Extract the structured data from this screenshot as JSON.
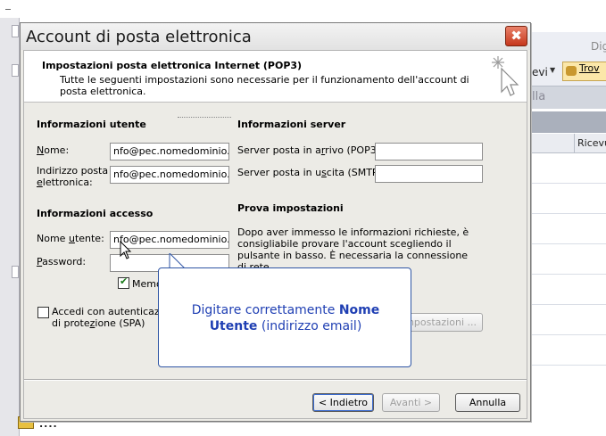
{
  "background": {
    "toolbar_partial_text": "Digi",
    "menu_partial": "evi",
    "find_button_partial": "Trov",
    "header_partial": "lla",
    "column_header_partial": "Ricevu",
    "bottom_dots": "...."
  },
  "dialog": {
    "title": "Account di posta elettronica",
    "close_glyph": "✖",
    "header_title": "Impostazioni posta elettronica Internet (POP3)",
    "header_desc": "Tutte le seguenti impostazioni sono necessarie per il funzionamento dell'account di posta elettronica.",
    "user_info": {
      "section": "Informazioni utente",
      "name_label_u": "N",
      "name_label_rest": "ome:",
      "name_value": "nfo@pec.nomedominio.",
      "email_label_1": "Indirizzo posta",
      "email_label_u": "e",
      "email_label_2": "lettronica:",
      "email_value": "nfo@pec.nomedominio."
    },
    "server_info": {
      "section": "Informazioni server",
      "incoming_pre": "Server posta in a",
      "incoming_u": "r",
      "incoming_post": "rivo (POP3):",
      "incoming_value": "",
      "outgoing_pre": "Server posta in u",
      "outgoing_u": "s",
      "outgoing_post": "cita (SMTP):",
      "outgoing_value": ""
    },
    "access_info": {
      "section": "Informazioni accesso",
      "username_pre": "Nome ",
      "username_u": "u",
      "username_post": "tente:",
      "username_value": "nfo@pec.nomedominio.",
      "password_u": "P",
      "password_rest": "assword:",
      "password_value": "",
      "remember_label": "Memor",
      "remember_checked": true,
      "spa_label_1": "Accedi con autenticazione",
      "spa_label_2_pre": "di prote",
      "spa_label_2_u": "z",
      "spa_label_2_post": "ione (SPA)",
      "spa_checked": false
    },
    "test_settings": {
      "section": "Prova impostazioni",
      "text": "Dopo aver immesso le informazioni richieste, è consigliabile provare l'account scegliendo il pulsante in basso. È necessaria la connessione di rete.",
      "test_button_partial": "mpostazioni ..."
    },
    "buttons": {
      "back": "< Indietro",
      "back_u": "I",
      "next": "Avanti >",
      "cancel": "Annulla"
    }
  },
  "callout": {
    "text_pre": "Digitare correttamente ",
    "text_bold": "Nome Utente",
    "text_post": " (indirizzo email)"
  }
}
